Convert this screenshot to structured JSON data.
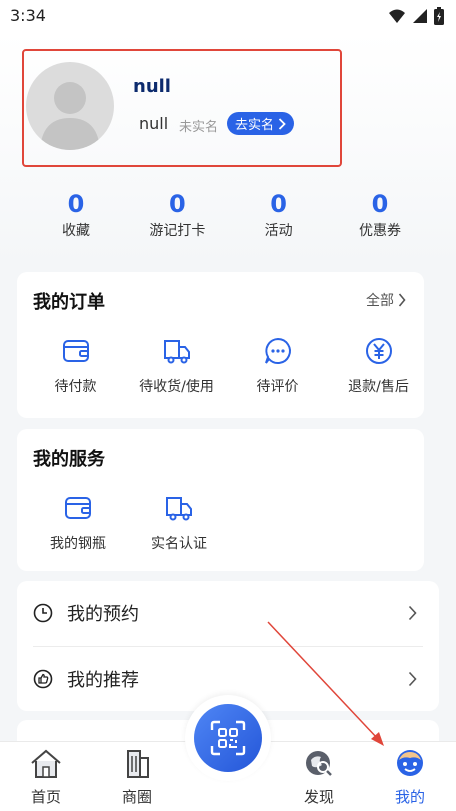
{
  "status_bar": {
    "time": "3:34",
    "icons": [
      "wifi-icon",
      "signal-icon",
      "battery-icon"
    ]
  },
  "profile": {
    "username": "null",
    "nickname": "null",
    "verify_status": "未实名",
    "verify_button": "去实名"
  },
  "stats": [
    {
      "value": "0",
      "label": "收藏"
    },
    {
      "value": "0",
      "label": "游记打卡"
    },
    {
      "value": "0",
      "label": "活动"
    },
    {
      "value": "0",
      "label": "优惠券"
    }
  ],
  "orders": {
    "title": "我的订单",
    "more": "全部",
    "items": [
      {
        "label": "待付款",
        "icon": "wallet-icon"
      },
      {
        "label": "待收货/使用",
        "icon": "truck-icon"
      },
      {
        "label": "待评价",
        "icon": "comment-icon"
      },
      {
        "label": "退款/售后",
        "icon": "yuan-icon"
      }
    ]
  },
  "services": {
    "title": "我的服务",
    "items": [
      {
        "label": "我的钢瓶",
        "icon": "wallet-icon"
      },
      {
        "label": "实名认证",
        "icon": "truck-icon"
      }
    ]
  },
  "list": [
    {
      "label": "我的预约",
      "icon": "clock-icon"
    },
    {
      "label": "我的推荐",
      "icon": "thumbs-up-icon"
    }
  ],
  "bottom_nav": [
    {
      "label": "首页",
      "icon": "home-icon"
    },
    {
      "label": "商圈",
      "icon": "building-icon"
    },
    {
      "label": "发现",
      "icon": "discover-icon"
    },
    {
      "label": "我的",
      "icon": "face-icon",
      "active": true
    }
  ],
  "colors": {
    "accent": "#2a63e6",
    "annotation": "#e0463a",
    "background": "#f4f6f8"
  }
}
